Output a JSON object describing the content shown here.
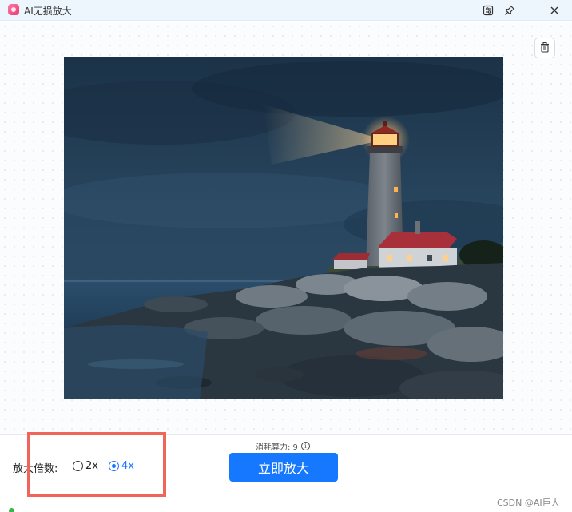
{
  "window": {
    "title": "AI无损放大",
    "buttons": [
      "settings-icon",
      "pin-icon",
      "close-icon"
    ]
  },
  "preview": {
    "delete_icon": "trash-icon",
    "image": "lighthouse-night-seascape"
  },
  "controls": {
    "scale_label": "放大倍数:",
    "options": [
      {
        "label": "2x",
        "selected": false
      },
      {
        "label": "4x",
        "selected": true
      }
    ],
    "cost_label": "消耗算力: 9",
    "enlarge_button": "立即放大"
  },
  "watermark": "CSDN @AI巨人",
  "colors": {
    "accent": "#1677ff",
    "highlight": "#f0645a",
    "titlebar": "#eef6fd"
  }
}
